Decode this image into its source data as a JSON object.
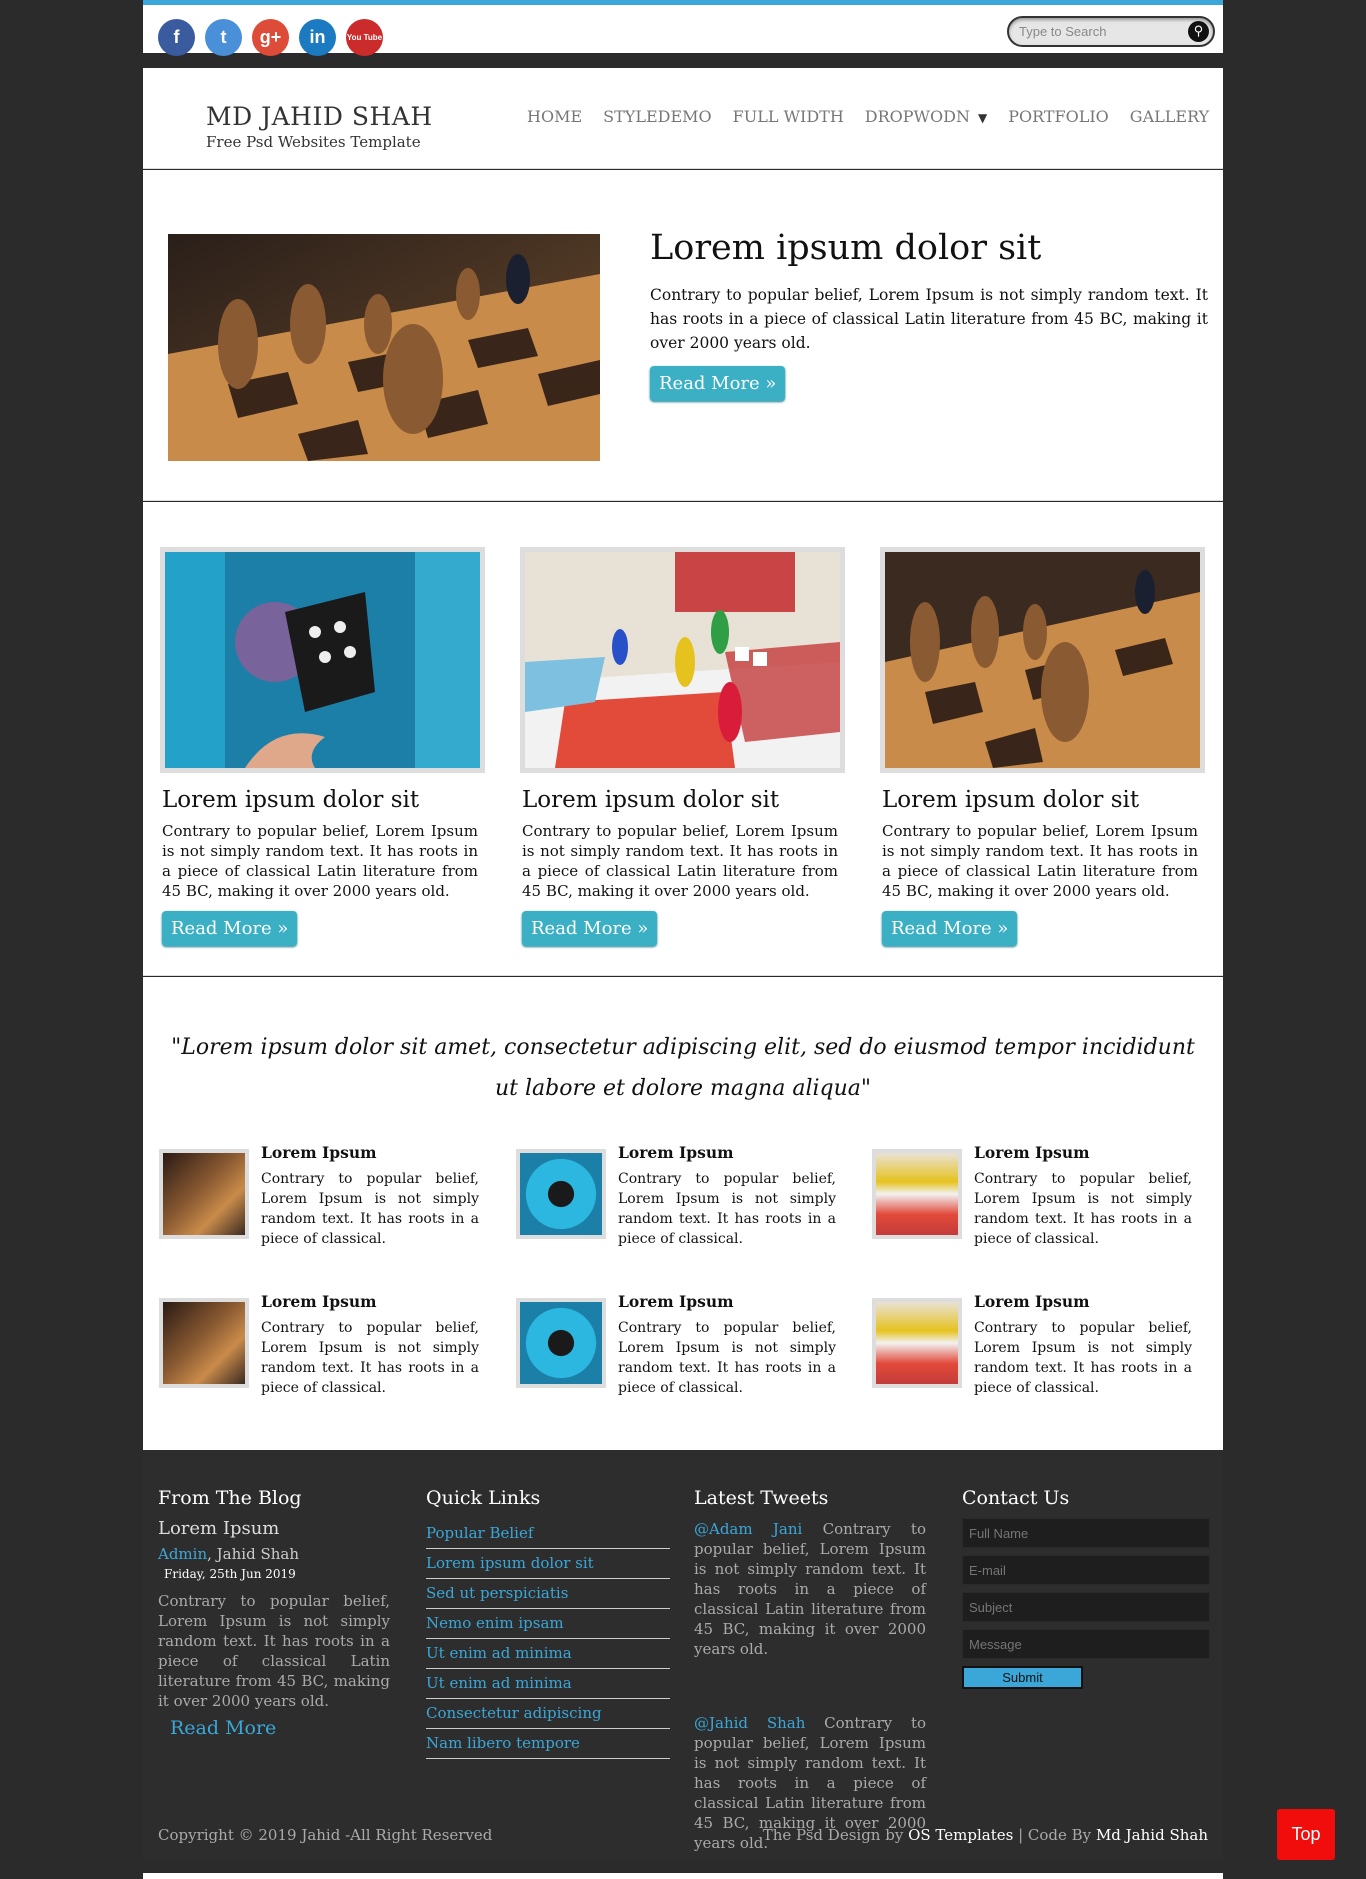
{
  "social": [
    "f",
    "t",
    "g+",
    "in",
    "You Tube"
  ],
  "search": {
    "placeholder": "Type to Search"
  },
  "logo": {
    "title": "MD JAHID SHAH",
    "subtitle": "Free Psd Websites Template"
  },
  "nav": [
    "HOME",
    "STYLEDEMO",
    "FULL WIDTH",
    "DROPWODN",
    "PORTFOLIO",
    "GALLERY"
  ],
  "hero": {
    "title": "Lorem ipsum dolor sit",
    "text": "Contrary to popular belief, Lorem Ipsum is not simply random text. It has roots in a piece of classical Latin literature from 45 BC, making it over 2000 years old.",
    "button": "Read More »"
  },
  "features": [
    {
      "title": "Lorem ipsum dolor sit",
      "text": "Contrary to popular belief, Lorem Ipsum is not simply random text. It has roots in a piece of classical Latin literature from 45 BC, making it over 2000 years old.",
      "button": "Read More »"
    },
    {
      "title": "Lorem ipsum dolor sit",
      "text": "Contrary to popular belief, Lorem Ipsum is not simply random text. It has roots in a piece of classical Latin literature from 45 BC, making it over 2000 years old.",
      "button": "Read More »"
    },
    {
      "title": "Lorem ipsum dolor sit",
      "text": "Contrary to popular belief, Lorem Ipsum is not simply random text. It has roots in a piece of classical Latin literature from 45 BC, making it over 2000 years old.",
      "button": "Read More »"
    }
  ],
  "quote": "\"Lorem ipsum dolor sit amet, consectetur adipiscing elit, sed do eiusmod tempor incididunt ut labore et dolore magna aliqua\"",
  "mini_items": [
    {
      "title": "Lorem Ipsum",
      "text": "Contrary to popular belief, Lorem Ipsum is not simply random text. It has roots in a piece of classical."
    },
    {
      "title": "Lorem Ipsum",
      "text": "Contrary to popular belief, Lorem Ipsum is not simply random text. It has roots in a piece of classical."
    },
    {
      "title": "Lorem Ipsum",
      "text": "Contrary to popular belief, Lorem Ipsum is not simply random text. It has roots in a piece of classical."
    },
    {
      "title": "Lorem Ipsum",
      "text": "Contrary to popular belief, Lorem Ipsum is not simply random text. It has roots in a piece of classical."
    },
    {
      "title": "Lorem Ipsum",
      "text": "Contrary to popular belief, Lorem Ipsum is not simply random text. It has roots in a piece of classical."
    },
    {
      "title": "Lorem Ipsum",
      "text": "Contrary to popular belief, Lorem Ipsum is not simply random text. It has roots in a piece of classical."
    }
  ],
  "footer": {
    "blog": {
      "heading": "From The Blog",
      "title": "Lorem Ipsum",
      "author_link": "Admin",
      "author_rest": ", Jahid Shah",
      "date": "Friday, 25th Jun 2019",
      "text": "Contrary to popular belief, Lorem Ipsum is not simply random text. It has roots in a piece of classical Latin literature from 45 BC, making it over 2000 years old.",
      "more": "Read More"
    },
    "quick_links": {
      "heading": "Quick Links",
      "items": [
        "Popular Belief",
        "Lorem ipsum dolor sit",
        "Sed ut perspiciatis",
        "Nemo enim ipsam",
        "Ut enim ad minima",
        "Ut enim ad minima",
        "Consectetur adipiscing",
        "Nam libero tempore"
      ]
    },
    "tweets": {
      "heading": "Latest Tweets",
      "items": [
        {
          "handle": "@Adam Jani",
          "text": " Contrary to popular belief, Lorem Ipsum is not simply random text. It has roots in a piece of classical Latin literature from 45 BC, making it over 2000 years old."
        },
        {
          "handle": "@Jahid Shah",
          "text": " Contrary to popular belief, Lorem Ipsum is not simply random text. It has roots in a piece of classical Latin literature from 45 BC, making it over 2000 years old."
        }
      ]
    },
    "contact": {
      "heading": "Contact Us",
      "fields": [
        "Full Name",
        "E-mail",
        "Subject",
        "Message"
      ],
      "submit": "Submit"
    },
    "copyright": "Copyright © 2019 Jahid -All Right Reserved",
    "credit_prefix": "The Psd Design by ",
    "credit_os": "OS Templates",
    "credit_mid": " | Code By ",
    "credit_author": "Md Jahid Shah"
  },
  "top_button": "Top",
  "colors": {
    "accent": "#3ba7d8",
    "button": "#3bb0c4",
    "footer_bg": "#2d2d2d",
    "top_button": "#f20d0d"
  }
}
